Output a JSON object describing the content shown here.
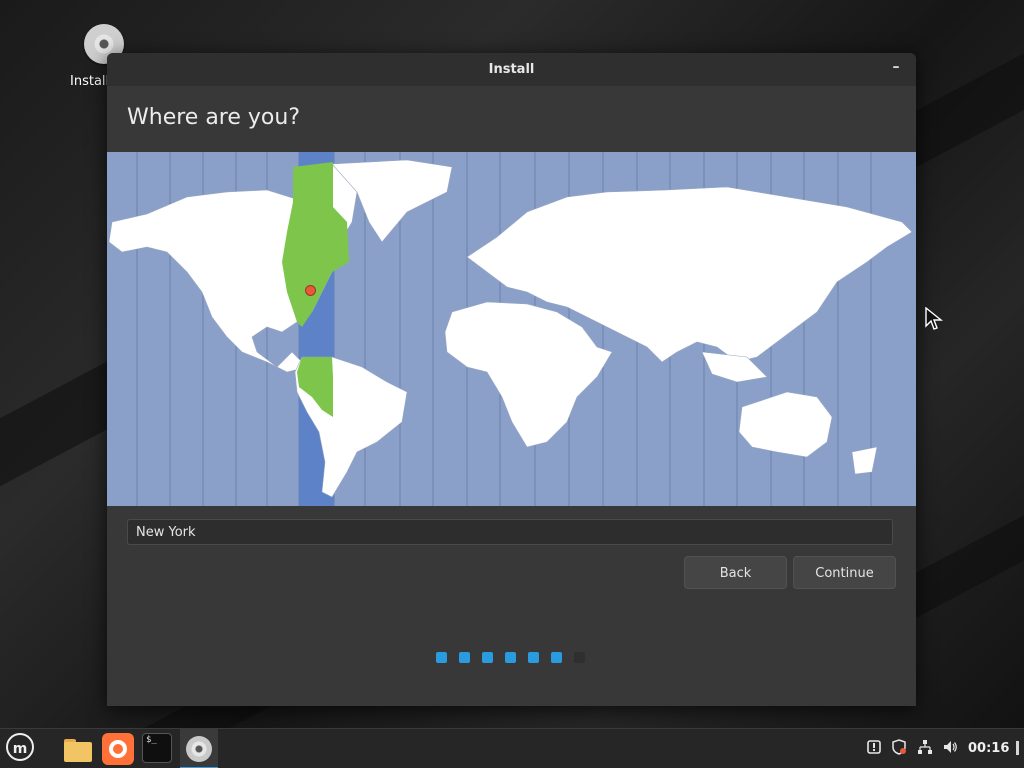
{
  "desktop": {
    "icon_label": "Install"
  },
  "window": {
    "title": "Install",
    "minimize_glyph": "–",
    "heading": "Where are you?",
    "location_value": "New York",
    "back_label": "Back",
    "continue_label": "Continue"
  },
  "progress": {
    "total_steps": 7,
    "completed_steps": 6,
    "active_color": "#2b9be0"
  },
  "map": {
    "selected_timezone_color": "#5e82c8",
    "land_color": "#ffffff",
    "selected_land_color": "#7dc64b",
    "ocean_color": "#8ba0c8"
  },
  "taskbar": {
    "apps": [
      "menu-icon",
      "files-icon",
      "firefox-icon",
      "terminal-icon",
      "install-disc-icon"
    ],
    "terminal_glyph": "$_",
    "menu_glyph": "m",
    "clock": "00:16"
  }
}
